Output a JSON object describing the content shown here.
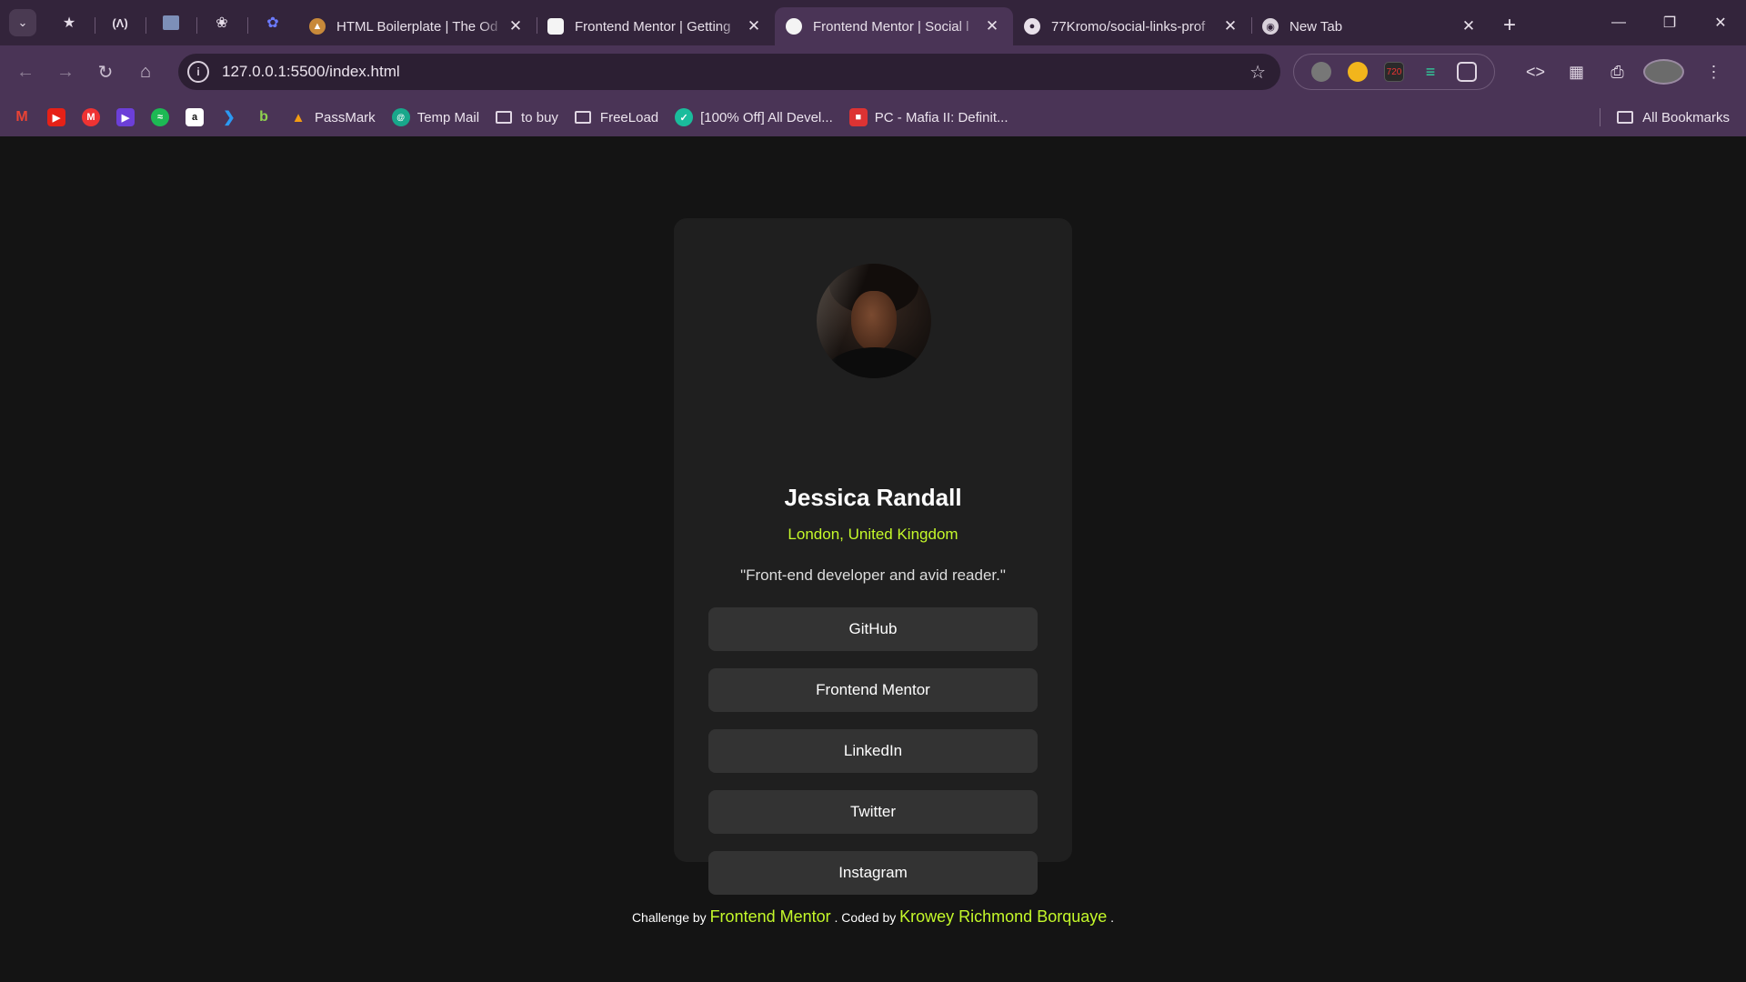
{
  "browser": {
    "tabs": [
      {
        "title": "HTML Boilerplate | The Od",
        "favicon": "odin-icon"
      },
      {
        "title": "Frontend Mentor | Getting",
        "favicon": "fm-icon"
      },
      {
        "title": "Frontend Mentor | Social l",
        "favicon": "fm-icon",
        "active": true
      },
      {
        "title": "77Kromo/social-links-prof",
        "favicon": "github-icon"
      },
      {
        "title": "New Tab",
        "favicon": "chrome-icon"
      }
    ],
    "url": "127.0.0.1:5500/index.html",
    "bookmarks": [
      {
        "label": "PassMark"
      },
      {
        "label": "Temp Mail"
      },
      {
        "label": "to buy"
      },
      {
        "label": "FreeLoad"
      },
      {
        "label": "[100% Off] All Devel..."
      },
      {
        "label": "PC - Mafia II: Definit..."
      }
    ],
    "all_bookmarks": "All Bookmarks"
  },
  "profile": {
    "name": "Jessica Randall",
    "location": "London, United Kingdom",
    "bio": "\"Front-end developer and avid reader.\"",
    "links": [
      "GitHub",
      "Frontend Mentor",
      "LinkedIn",
      "Twitter",
      "Instagram"
    ]
  },
  "footer": {
    "challenge_prefix": "Challenge by",
    "challenge_link": "Frontend Mentor",
    "coded_prefix": ". Coded by",
    "coded_link": "Krowey Richmond Borquaye",
    "suffix": "."
  },
  "colors": {
    "accent": "#c4f82a",
    "card": "#1f1f1f",
    "button": "#333333",
    "page": "#141414"
  }
}
